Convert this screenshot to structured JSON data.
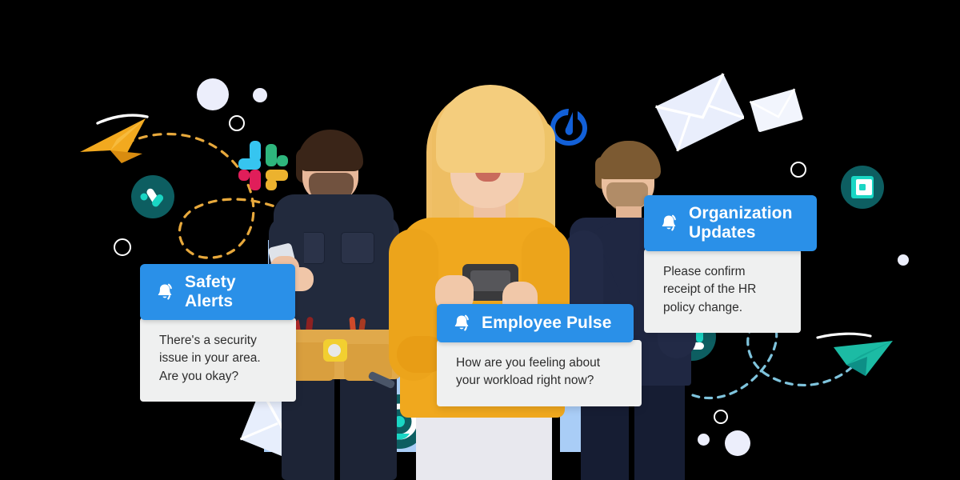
{
  "meta": {
    "background_color": "#000000",
    "accent_blue": "#2a90e8",
    "card_body_bg": "#eff0f0",
    "panel_blue": "#a9cdf6",
    "teal": "#0d5e61",
    "teal_bright": "#1ad6c4"
  },
  "cards": [
    {
      "id": "safety",
      "title": "Safety Alerts",
      "message": "There's a security issue in your area. Are you okay?",
      "icon": "bell-icon"
    },
    {
      "id": "pulse",
      "title": "Employee Pulse",
      "message": "How are you feeling about your workload right now?",
      "icon": "bell-icon"
    },
    {
      "id": "org",
      "title": "Organization Updates",
      "message": "Please confirm receipt of the HR policy change.",
      "icon": "bell-icon"
    }
  ],
  "brand_logos": [
    {
      "name": "slack-logo",
      "colors": [
        "#36c5f0",
        "#2eb67d",
        "#ecb22e",
        "#e01e5a"
      ]
    },
    {
      "name": "mattermost-logo",
      "color": "#1260d8"
    }
  ],
  "decorations": {
    "paper_planes": [
      {
        "name": "paper-plane-orange",
        "color": "#f0a41e",
        "trail": "white-swoosh"
      },
      {
        "name": "paper-plane-teal",
        "color": "#17b39a",
        "trail": "dashed"
      }
    ],
    "envelopes": [
      {
        "name": "envelope-large-top-right",
        "color": "#eaeffb"
      },
      {
        "name": "envelope-small-top-right",
        "color": "#f2f5fd"
      },
      {
        "name": "envelope-bottom-left",
        "color": "#e7eefc"
      },
      {
        "name": "envelope-bottom-left-small",
        "color": "#eef2fd"
      }
    ],
    "badge_icons": [
      {
        "name": "send-arrow-badge",
        "color": "#0d5e61"
      },
      {
        "name": "target-badge",
        "color": "#0d5e61"
      },
      {
        "name": "chat-blocks-badge",
        "color": "#0d5e61"
      },
      {
        "name": "frame-badge",
        "color": "#0d5e61"
      }
    ],
    "dashed_trails": [
      {
        "name": "dashed-loop-orange",
        "color": "#e8a93c"
      },
      {
        "name": "dashed-loop-blue",
        "color": "#7fc4dd"
      }
    ]
  },
  "people": [
    {
      "name": "worker-in-navy-coveralls",
      "holding": "mobile-phone"
    },
    {
      "name": "woman-in-yellow-sweater",
      "holding": "mobile-phone"
    },
    {
      "name": "man-in-navy-suit",
      "holding": "mobile-phone"
    }
  ]
}
